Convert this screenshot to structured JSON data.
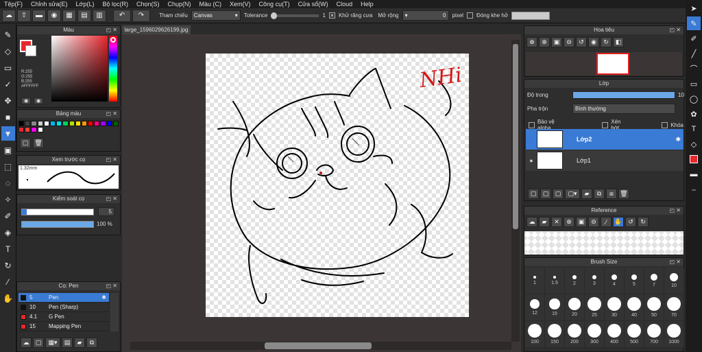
{
  "menu": [
    "Tệp(F)",
    "Chỉnh sửa(E)",
    "Lớp(L)",
    "Bộ lọc(R)",
    "Chọn(S)",
    "Chụp(N)",
    "Màu (C)",
    "Xem(V)",
    "Công cụ(T)",
    "Cửa sổ(W)",
    "Cloud",
    "Help"
  ],
  "toolbar": {
    "ref_label": "Tham chiếu",
    "ref_value": "Canvas",
    "tolerance_label": "Tolerance",
    "tolerance_value": "1",
    "antialias_label": "Khử răng cưa",
    "expand_label": "Mở rộng",
    "expand_value": "0",
    "pixel_label": "pixel",
    "close_gap_label": "Đóng khe hở"
  },
  "color_panel": {
    "title": "Màu",
    "r": "R:255",
    "g": "G:255",
    "b": "B:255",
    "hex": "#FFFFFF",
    "fg": "#e8262e",
    "bg": "#ffffff"
  },
  "palette_panel": {
    "title": "Bảng màu",
    "swatches": [
      "#000000",
      "#444444",
      "#888888",
      "#cccccc",
      "#ffffff",
      "#00b7eb",
      "#00e0e0",
      "#00d060",
      "#b0e000",
      "#ffe000",
      "#ff9900",
      "#ff0000",
      "#ff0080",
      "#a000ff",
      "#0000ff",
      "#006000",
      "#e8262e",
      "#ff4040",
      "#ff00ff",
      "#ffffff"
    ]
  },
  "brush_preview": {
    "title": "Xem trước cọ",
    "size": "1.32mm"
  },
  "brush_control": {
    "title": "Kiểm soát cọ",
    "size_value": "5",
    "opacity_value": "100 %",
    "opacity": 1.0
  },
  "brush_list": {
    "title": "Cọ: Pen",
    "items": [
      {
        "size": "5",
        "name": "Pen",
        "color": "#111111"
      },
      {
        "size": "10",
        "name": "Pen (Sharp)",
        "color": "#111111"
      },
      {
        "size": "4.1",
        "name": "G Pen",
        "color": "#e8262e"
      },
      {
        "size": "15",
        "name": "Mapping Pen",
        "color": "#e8262e"
      }
    ]
  },
  "document": {
    "tab": "large_1596029626199.jpg",
    "signature_text": "NHi"
  },
  "navigator": {
    "title": "Hoa tiêu"
  },
  "layer_panel": {
    "title": "Lớp",
    "opacity_label": "Độ trong",
    "opacity_value": "10",
    "blend_label": "Pha trộn",
    "blend_value": "Bình thường",
    "protect_alpha": "Bảo vệ alpha",
    "clipping": "Xén bớt",
    "lock": "Khóa",
    "layers": [
      {
        "name": "Lớp2",
        "selected": true
      },
      {
        "name": "Lớp1",
        "selected": false
      }
    ]
  },
  "reference_panel": {
    "title": "Reference"
  },
  "brush_size_panel": {
    "title": "Brush Size",
    "sizes": [
      "1",
      "1.5",
      "2",
      "3",
      "4",
      "5",
      "7",
      "10",
      "12",
      "15",
      "20",
      "25",
      "30",
      "40",
      "50",
      "70",
      "100",
      "150",
      "200",
      "300",
      "400",
      "500",
      "700",
      "1000"
    ]
  }
}
